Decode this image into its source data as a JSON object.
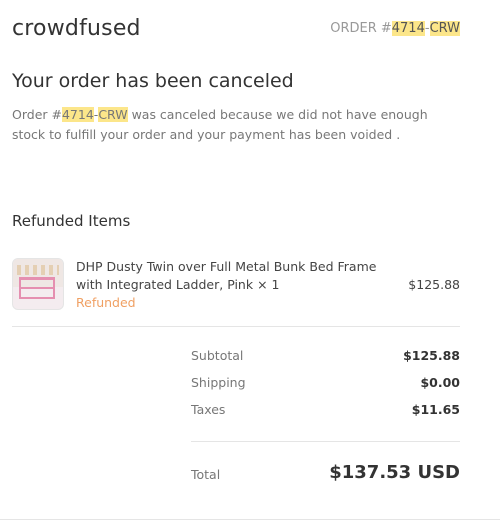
{
  "header": {
    "brand": "crowdfused",
    "order_prefix": "ORDER #",
    "order_number": "4714",
    "order_dash": "-",
    "order_suffix": "CRW"
  },
  "cancellation": {
    "title": "Your order has been canceled",
    "message_prefix": "Order #",
    "order_number": "4714",
    "order_dash": "-",
    "order_suffix": "CRW",
    "message_rest": " was canceled because we did not have enough stock to fulfill your order and your payment has been voided ."
  },
  "refunded": {
    "title": "Refunded Items",
    "items": [
      {
        "name": "DHP Dusty Twin over Full Metal Bunk Bed Frame with Integrated Ladder, Pink × 1",
        "status": "Refunded",
        "price": "$125.88",
        "thumbnail_icon": "bunk-bed-image"
      }
    ]
  },
  "summary": {
    "subtotal_label": "Subtotal",
    "subtotal_value": "$125.88",
    "shipping_label": "Shipping",
    "shipping_value": "$0.00",
    "taxes_label": "Taxes",
    "taxes_value": "$11.65",
    "total_label": "Total",
    "total_value": "$137.53 USD"
  },
  "colors": {
    "highlight": "#fce68a",
    "refunded_status": "#f0a063"
  }
}
